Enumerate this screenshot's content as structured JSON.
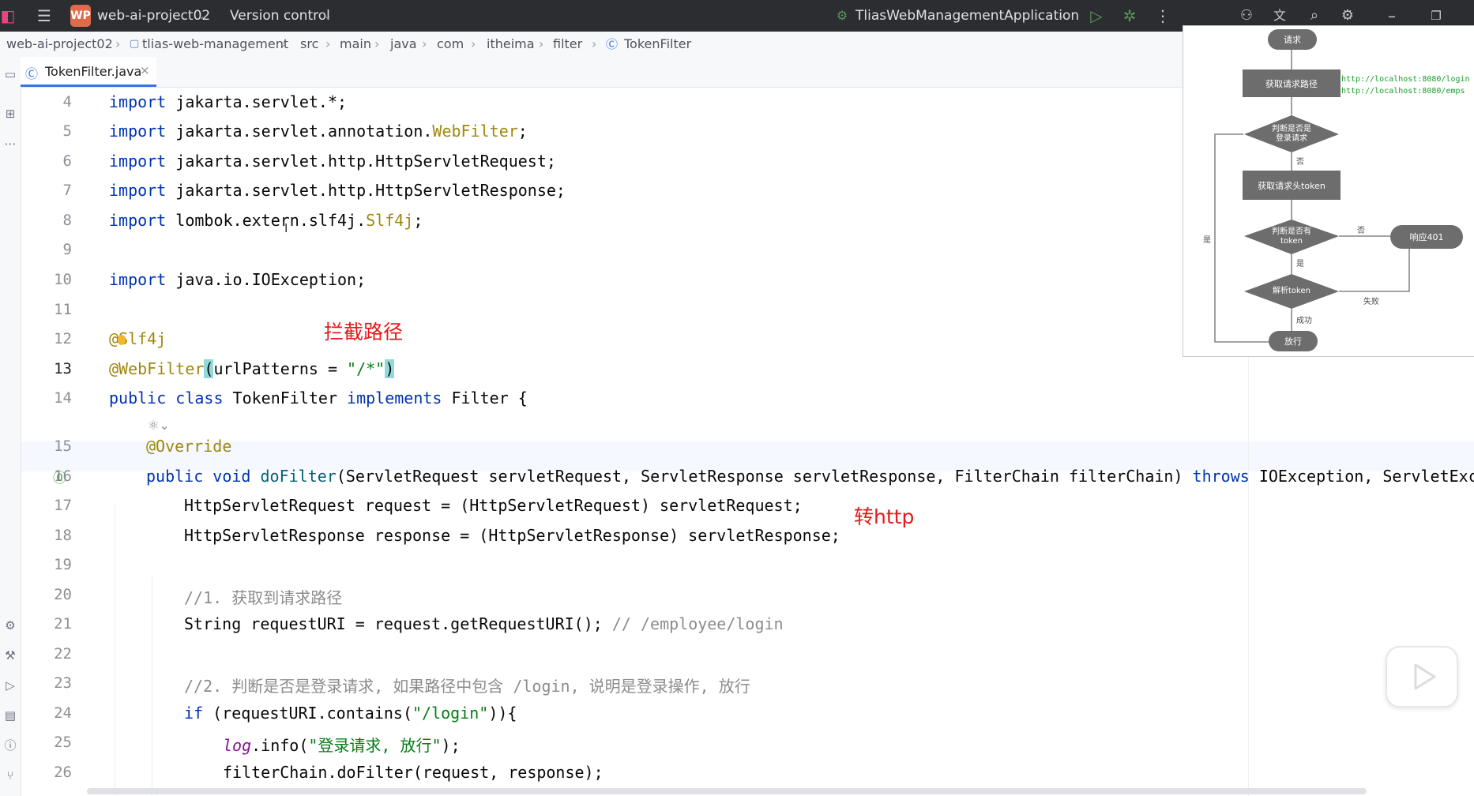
{
  "titlebar": {
    "project_badge": "WP",
    "project_name": "web-ai-project02",
    "vcs": "Version control",
    "run_config": "TliasWebManagementApplication"
  },
  "breadcrumb": [
    "web-ai-project02",
    "tlias-web-management",
    "src",
    "main",
    "java",
    "com",
    "itheima",
    "filter",
    "TokenFilter"
  ],
  "tab": {
    "label": "TokenFilter.java",
    "close": "×"
  },
  "line_numbers": [
    "4",
    "5",
    "6",
    "7",
    "8",
    "9",
    "10",
    "11",
    "12",
    "13",
    "14",
    "15",
    "16",
    "17",
    "18",
    "19",
    "20",
    "21",
    "22",
    "23",
    "24",
    "25",
    "26"
  ],
  "code": {
    "l4": [
      "import",
      " jakarta.servlet.*;"
    ],
    "l5": [
      "import",
      " jakarta.servlet.annotation.",
      "WebFilter",
      ";"
    ],
    "l6": [
      "import",
      " jakarta.servlet.http.HttpServletRequest;"
    ],
    "l7": [
      "import",
      " jakarta.servlet.http.HttpServletResponse;"
    ],
    "l8": [
      "import",
      " lombok.extern.slf4j.",
      "Slf4j",
      ";"
    ],
    "l10": [
      "import",
      " java.io.IOException;"
    ],
    "l12": "@Slf4j",
    "l13": [
      "@WebFilter",
      "(",
      "urlPatterns = ",
      "\"/*\"",
      ")"
    ],
    "l14": [
      "public class",
      " TokenFilter ",
      "implements",
      " Filter {"
    ],
    "l15": "@Override",
    "l16": [
      "public void",
      " ",
      "doFilter",
      "(ServletRequest servletRequest, ServletResponse servletResponse, FilterChain filterChain) ",
      "throws",
      " IOException, ServletExcep"
    ],
    "l17": "HttpServletRequest request = (HttpServletRequest) servletRequest;",
    "l18": "HttpServletResponse response = (HttpServletResponse) servletResponse;",
    "l20": "//1. 获取到请求路径",
    "l21": [
      "String requestURI = request.getRequestURI(); ",
      "// /employee/login"
    ],
    "l23": "//2. 判断是否是登录请求, 如果路径中包含 /login, 说明是登录操作, 放行",
    "l24": [
      "if",
      " (requestURI.contains(",
      "\"/login\"",
      ")){"
    ],
    "l25": [
      "log",
      ".info(",
      "\"登录请求, 放行\"",
      ");"
    ],
    "l26": "filterChain.doFilter(request, response);"
  },
  "annotations": {
    "intercept_path": "拦截路径",
    "to_http": "转http"
  },
  "flowchart": {
    "start": "请求",
    "get_path": "获取请求路径",
    "is_login": "判断是否是\n登录请求",
    "get_token": "获取请求头token",
    "has_token": "判断是否有\ntoken",
    "resp401": "响应401",
    "parse_token": "解析token",
    "pass": "放行",
    "label_no": "否",
    "label_no2": "否",
    "label_yes": "是",
    "label_yes_left": "是",
    "label_fail": "失败",
    "label_success": "成功",
    "url1": "http://localhost:8080/login",
    "url2": "http://localhost:8080/emps"
  },
  "colors": {
    "keyword": "#0033b3",
    "annotation": "#9e880d",
    "string": "#067d17",
    "comment": "#8c8c8c",
    "note_red": "#e61919"
  }
}
